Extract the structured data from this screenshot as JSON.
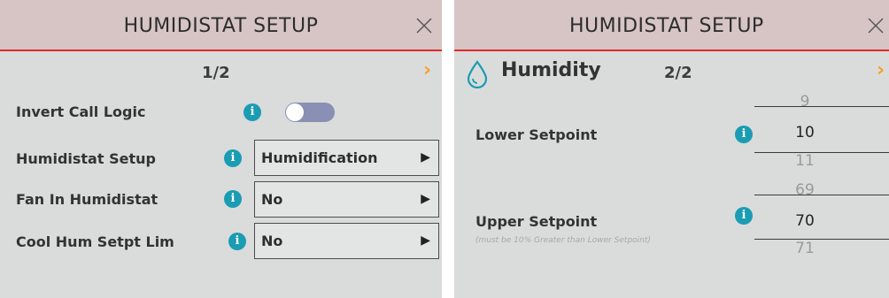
{
  "left_panel": {
    "title": "HUMIDISTAT SETUP",
    "page": "1/2",
    "next_arrow": "›",
    "rows": [
      {
        "label": "Invert Call Logic",
        "control": "toggle",
        "toggle_on": false
      },
      {
        "label": "Humidistat Setup",
        "value": "Humidification"
      },
      {
        "label": "Fan In Humidistat",
        "value": "No"
      },
      {
        "label": "Cool Hum Setpt Lim",
        "value": "No"
      }
    ]
  },
  "right_panel": {
    "title": "HUMIDISTAT SETUP",
    "section_title": "Humidity",
    "page": "2/2",
    "next_arrow": "›",
    "lower_setpoint": {
      "label": "Lower Setpoint",
      "prev": "9",
      "value": "10",
      "next": "11"
    },
    "upper_setpoint": {
      "label": "Upper Setpoint",
      "prev": "69",
      "value": "70",
      "next": "71",
      "note": "(must be 10% Greater than Lower Setpoint)"
    }
  },
  "icons": {
    "info": "i",
    "select_arrow": "▶"
  },
  "colors": {
    "accent_red": "#e0282e",
    "header_bg": "#d7c5c6",
    "info_blue": "#1a9cb3",
    "arrow_orange": "#f3a22b",
    "toggle_off": "#8a8fb4",
    "panel_bg": "#d9dcdb"
  }
}
